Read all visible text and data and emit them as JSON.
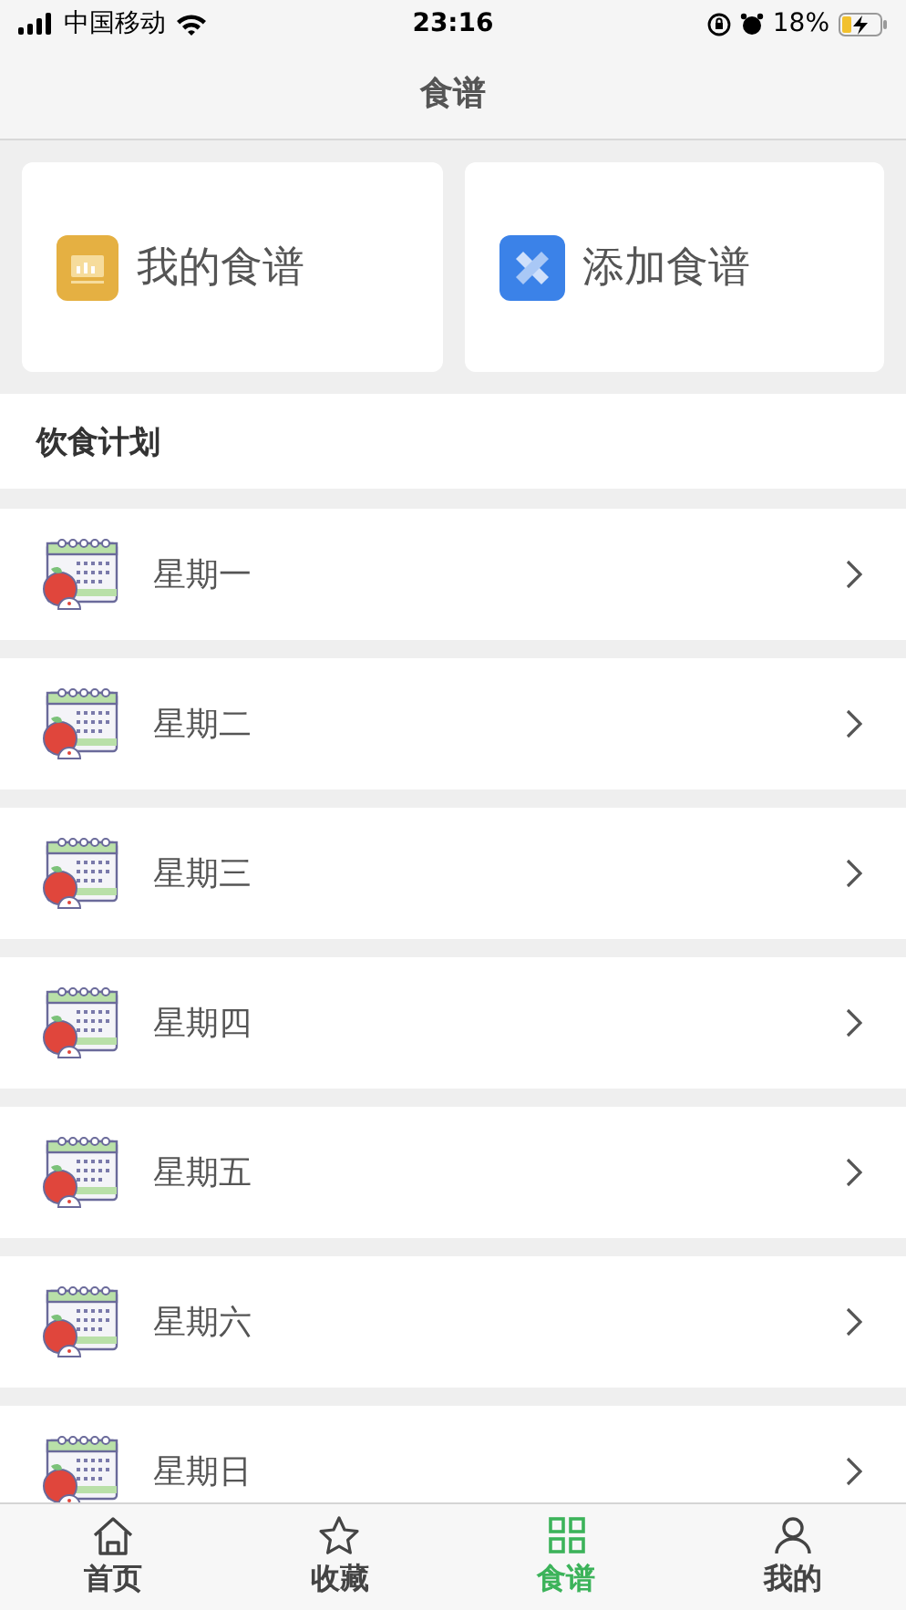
{
  "status_bar": {
    "carrier": "中国移动",
    "time": "23:16",
    "battery": "18%"
  },
  "nav": {
    "title": "食谱"
  },
  "cards": [
    {
      "kind": "mine",
      "label": "我的食谱"
    },
    {
      "kind": "add",
      "label": "添加食谱"
    }
  ],
  "section": {
    "title": "饮食计划"
  },
  "plan_items": [
    {
      "label": "星期一"
    },
    {
      "label": "星期二"
    },
    {
      "label": "星期三"
    },
    {
      "label": "星期四"
    },
    {
      "label": "星期五"
    },
    {
      "label": "星期六"
    },
    {
      "label": "星期日"
    }
  ],
  "tabs": [
    {
      "kind": "home",
      "label": "首页",
      "selected": false
    },
    {
      "kind": "star",
      "label": "收藏",
      "selected": false
    },
    {
      "kind": "grid",
      "label": "食谱",
      "selected": true
    },
    {
      "kind": "user",
      "label": "我的",
      "selected": false
    }
  ]
}
